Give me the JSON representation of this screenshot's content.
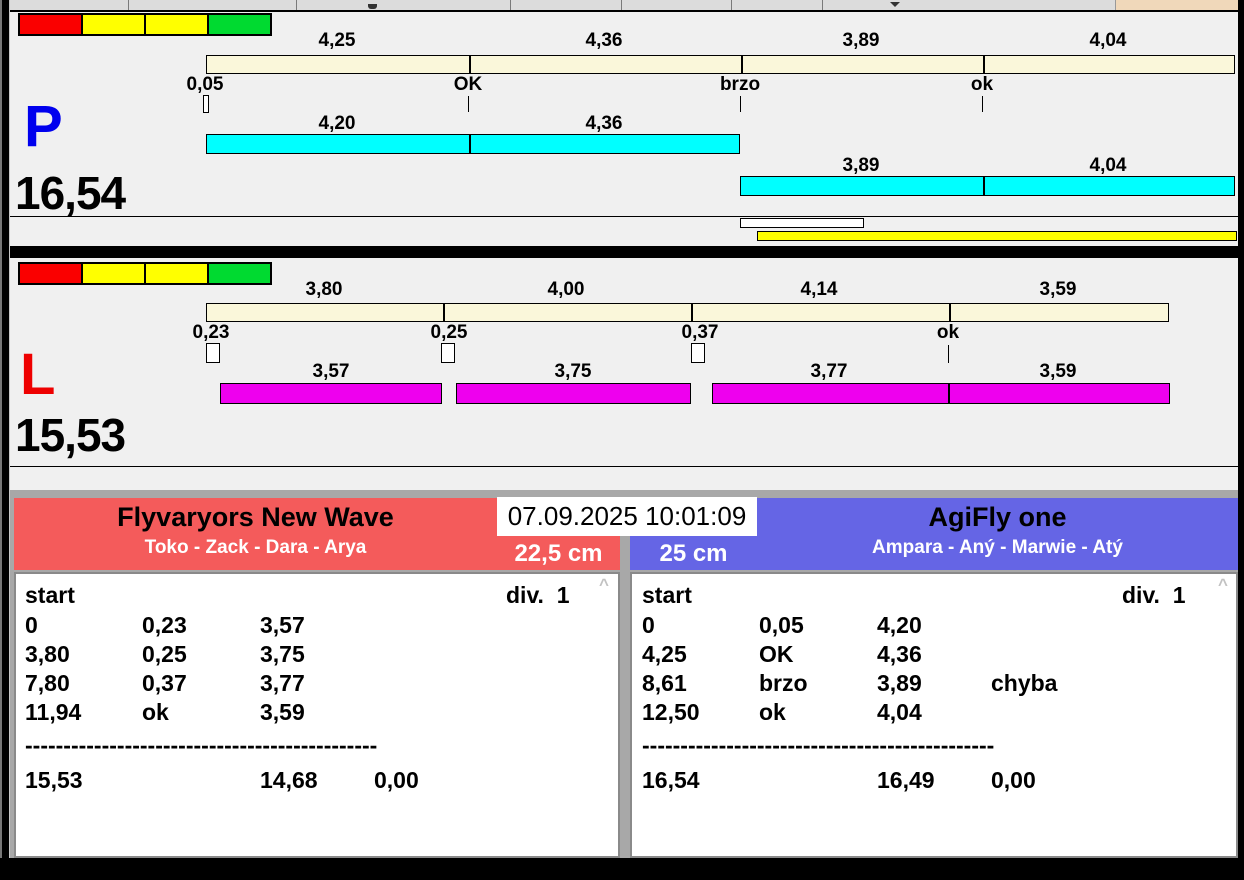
{
  "datetime": "07.09.2025 10:01:09",
  "colors": {
    "legend_red": "#fa0000",
    "legend_yellow": "#ffff00",
    "legend_green": "#00da30",
    "split_bar_cream": "#faf7da",
    "run_bar_p_cyan": "#00ffff",
    "run_bar_l_magenta": "#ee00ee",
    "lane_p_letter_blue": "#0000ee",
    "lane_l_letter_red": "#ee0000",
    "team_left_header_red": "#f45b5b",
    "team_right_header_blue": "#6565e5",
    "highlight_bar_yellow": "#ffff00"
  },
  "lane_p": {
    "letter": "P",
    "total": "16,54",
    "split_labels": [
      "4,25",
      "4,36",
      "3,89",
      "4,04"
    ],
    "gate_labels": [
      "0,05",
      "OK",
      "brzo",
      "ok"
    ],
    "run1_labels": [
      "4,20",
      "4,36"
    ],
    "run2_labels": [
      "3,89",
      "4,04"
    ]
  },
  "lane_l": {
    "letter": "L",
    "total": "15,53",
    "split_labels": [
      "3,80",
      "4,00",
      "4,14",
      "3,59"
    ],
    "gate_labels": [
      "0,23",
      "0,25",
      "0,37",
      "ok"
    ],
    "run_labels": [
      "3,57",
      "3,75",
      "3,77",
      "3,59"
    ]
  },
  "team_left": {
    "name": "Flyvaryors New Wave",
    "members": "Toko - Zack - Dara - Arya",
    "height": "22,5 cm",
    "table": {
      "header": "start",
      "division": "div.  1",
      "rows": [
        [
          "0",
          "0,23",
          "3,57",
          ""
        ],
        [
          "3,80",
          "0,25",
          "3,75",
          ""
        ],
        [
          "7,80",
          "0,37",
          "3,77",
          ""
        ],
        [
          "11,94",
          "ok",
          "3,59",
          ""
        ]
      ],
      "separator": "----------------------------------------------",
      "total_time": "15,53",
      "clean_time": "14,68",
      "penalty": "0,00"
    }
  },
  "team_right": {
    "name": "AgiFly one",
    "members": "Ampara - Aný - Marwie - Atý",
    "height": "25 cm",
    "table": {
      "header": "start",
      "division": "div.  1",
      "rows": [
        [
          "0",
          "0,05",
          "4,20",
          ""
        ],
        [
          "4,25",
          "OK",
          "4,36",
          ""
        ],
        [
          "8,61",
          "brzo",
          "3,89",
          "chyba"
        ],
        [
          "12,50",
          "ok",
          "4,04",
          ""
        ]
      ],
      "separator": "----------------------------------------------",
      "total_time": "16,54",
      "clean_time": "16,49",
      "penalty": "0,00"
    }
  },
  "icons": {
    "scroll_up": "^"
  }
}
